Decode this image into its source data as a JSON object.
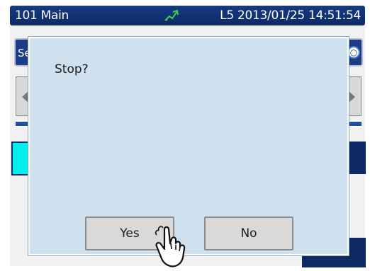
{
  "status_bar": {
    "left_text": "101 Main",
    "right_text": "L5 2013/01/25 14:51:54",
    "icon": "signal-icon"
  },
  "background": {
    "tab_left_label": "Se",
    "tab_right_icon": "circle-icon"
  },
  "dialog": {
    "message": "Stop?",
    "yes_label": "Yes",
    "no_label": "No"
  },
  "cursor": {
    "icon": "hand-pointer-icon"
  },
  "colors": {
    "status_bar": "#0d2a66",
    "dialog_bg": "#cfe0ee",
    "button_bg": "#d9d9d9",
    "accent_cyan": "#00f0f0"
  }
}
